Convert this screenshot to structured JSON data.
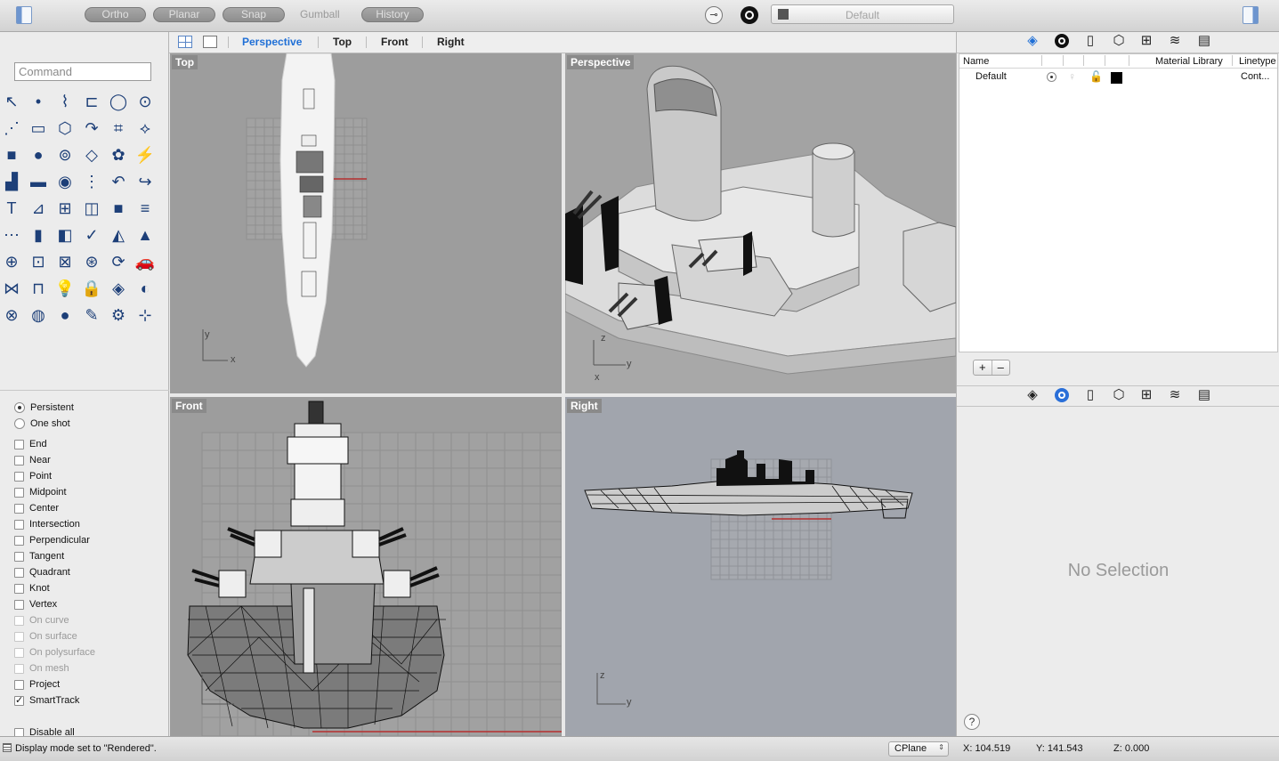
{
  "toolbar": {
    "ortho": "Ortho",
    "planar": "Planar",
    "snap": "Snap",
    "gumball": "Gumball",
    "history": "History",
    "layer_name": "Default"
  },
  "view_tabs": [
    "Perspective",
    "Top",
    "Front",
    "Right"
  ],
  "command": {
    "placeholder": "Command"
  },
  "tool_icons": [
    "select-arrow-icon",
    "point-icon",
    "polyline-icon",
    "rectangle-icon",
    "circle-icon",
    "ellipse-icon",
    "curve-edit-icon",
    "rect-corner-icon",
    "polygon-icon",
    "arc-icon",
    "curve-tools-icon",
    "curve-shape-icon",
    "box-icon",
    "sphere-icon",
    "cylinder-icon",
    "surface-icon",
    "gear-group-icon",
    "explode-icon",
    "extrude-icon",
    "extrude-line-icon",
    "boolean-icon",
    "boolean-split-icon",
    "curve-arc-icon",
    "curve-chain-icon",
    "text-icon",
    "transform-icon",
    "array-icon",
    "rotate-icon",
    "solid-box-icon",
    "ruler-icon",
    "grid-array-icon",
    "dimension-icon",
    "layout-icon",
    "check-icon",
    "analyze-icon",
    "warning-icon",
    "zoom-icon",
    "zoom-window-icon",
    "zoom-extent-icon",
    "pan-icon",
    "rotate-view-icon",
    "car-icon",
    "mesh-icon",
    "group-icon",
    "light-icon",
    "lock-icon",
    "material-icon",
    "color-wheel-icon",
    "globe-icon",
    "render-sphere-icon",
    "blue-sphere-icon",
    "pencil-icon",
    "gear-settings-icon",
    "dimension-tools-icon"
  ],
  "osnaps": {
    "persistent": "Persistent",
    "one_shot": "One shot",
    "items": [
      {
        "label": "End",
        "checked": false,
        "dim": false
      },
      {
        "label": "Near",
        "checked": false,
        "dim": false
      },
      {
        "label": "Point",
        "checked": false,
        "dim": false
      },
      {
        "label": "Midpoint",
        "checked": false,
        "dim": false
      },
      {
        "label": "Center",
        "checked": false,
        "dim": false
      },
      {
        "label": "Intersection",
        "checked": false,
        "dim": false
      },
      {
        "label": "Perpendicular",
        "checked": false,
        "dim": false
      },
      {
        "label": "Tangent",
        "checked": false,
        "dim": false
      },
      {
        "label": "Quadrant",
        "checked": false,
        "dim": false
      },
      {
        "label": "Knot",
        "checked": false,
        "dim": false
      },
      {
        "label": "Vertex",
        "checked": false,
        "dim": false
      },
      {
        "label": "On curve",
        "checked": false,
        "dim": true
      },
      {
        "label": "On surface",
        "checked": false,
        "dim": true
      },
      {
        "label": "On polysurface",
        "checked": false,
        "dim": true
      },
      {
        "label": "On mesh",
        "checked": false,
        "dim": true
      },
      {
        "label": "Project",
        "checked": false,
        "dim": false
      },
      {
        "label": "SmartTrack",
        "checked": true,
        "dim": false
      }
    ],
    "disable_all": "Disable all"
  },
  "viewports": {
    "top": "Top",
    "perspective": "Perspective",
    "front": "Front",
    "right": "Right"
  },
  "axes": {
    "x": "x",
    "y": "y",
    "z": "z"
  },
  "layers": {
    "col_name": "Name",
    "col_material": "Material Library",
    "col_linetype": "Linetype",
    "rows": [
      {
        "name": "Default",
        "linetype": "Cont..."
      }
    ],
    "add": "+",
    "remove": "–"
  },
  "properties": {
    "no_selection": "No Selection",
    "help": "?"
  },
  "status": {
    "message": "Display mode set to \"Rendered\".",
    "cplane": "CPlane",
    "x": "X: 104.519",
    "y": "Y: 141.543",
    "z": "Z: 0.000"
  },
  "colors": {
    "accent": "#1f6fd6",
    "viewport_bg": "#9d9d9d",
    "x_axis": "#b52f2f"
  }
}
